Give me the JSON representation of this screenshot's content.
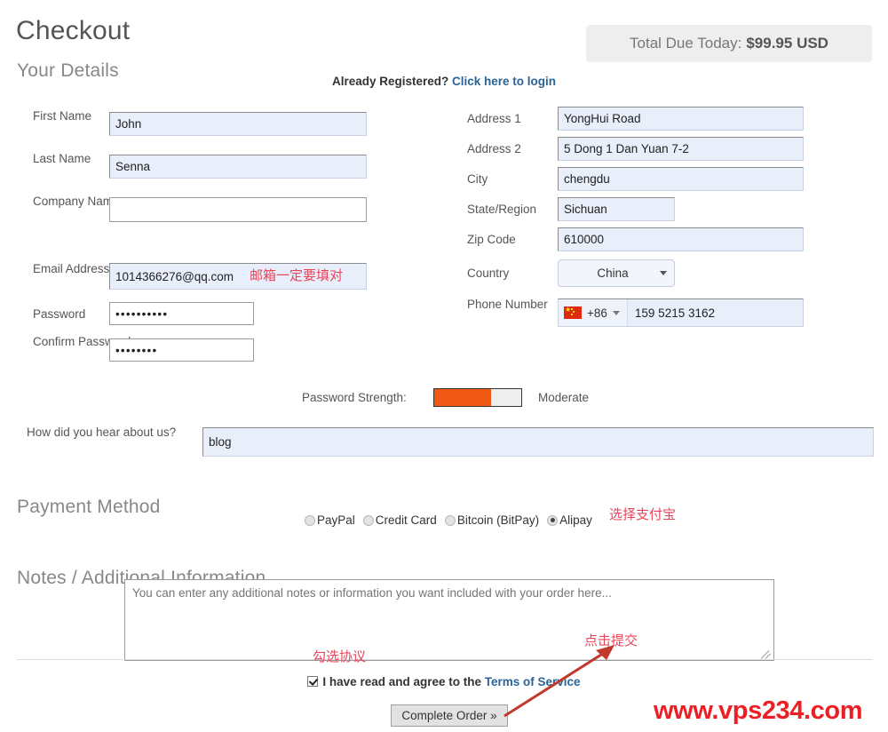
{
  "page": {
    "title": "Checkout",
    "sections": {
      "your_details": "Your Details",
      "payment_method": "Payment Method",
      "notes": "Notes / Additional Information"
    }
  },
  "total_due": {
    "label": "Total Due Today:",
    "amount": "$99.95 USD"
  },
  "login_prompt": {
    "text": "Already Registered?",
    "link": "Click here to login"
  },
  "left_form": {
    "first_name": {
      "label": "First Name",
      "value": "John"
    },
    "last_name": {
      "label": "Last Name",
      "value": "Senna"
    },
    "company_name": {
      "label": "Company Name",
      "value": ""
    },
    "email": {
      "label": "Email Address",
      "value": "1014366276@qq.com"
    },
    "password": {
      "label": "Password",
      "value": "••••••••••"
    },
    "confirm_password": {
      "label": "Confirm Password",
      "value": "••••••••"
    }
  },
  "right_form": {
    "address1": {
      "label": "Address 1",
      "value": "YongHui Road"
    },
    "address2": {
      "label": "Address 2",
      "value": "5 Dong 1 Dan Yuan 7-2"
    },
    "city": {
      "label": "City",
      "value": "chengdu"
    },
    "state": {
      "label": "State/Region",
      "value": "Sichuan"
    },
    "zip": {
      "label": "Zip Code",
      "value": "610000"
    },
    "country": {
      "label": "Country",
      "value": "China"
    },
    "phone": {
      "label": "Phone Number",
      "country_code": "+86",
      "flag": "cn-flag-icon",
      "value": "159 5215 3162"
    }
  },
  "password_strength": {
    "label": "Password Strength:",
    "percent": 65,
    "rating": "Moderate",
    "fill_color": "#f05a14"
  },
  "hear_about": {
    "label": "How did you hear about us?",
    "value": "blog"
  },
  "payment_options": [
    {
      "label": "PayPal",
      "selected": false
    },
    {
      "label": "Credit Card",
      "selected": false
    },
    {
      "label": "Bitcoin (BitPay)",
      "selected": false
    },
    {
      "label": "Alipay",
      "selected": true
    }
  ],
  "notes_field": {
    "placeholder": "You can enter any additional notes or information you want included with your order here...",
    "value": ""
  },
  "terms": {
    "checked": true,
    "text_before": "I have read and agree to the",
    "link": "Terms of Service"
  },
  "submit": {
    "label": "Complete Order »"
  },
  "annotations": {
    "email": "邮箱一定要填对",
    "alipay": "选择支付宝",
    "terms": "勾选协议",
    "submit": "点击提交",
    "color": "#e8455a"
  },
  "watermark": {
    "text": "www.vps234.com",
    "color": "#ec2024"
  }
}
